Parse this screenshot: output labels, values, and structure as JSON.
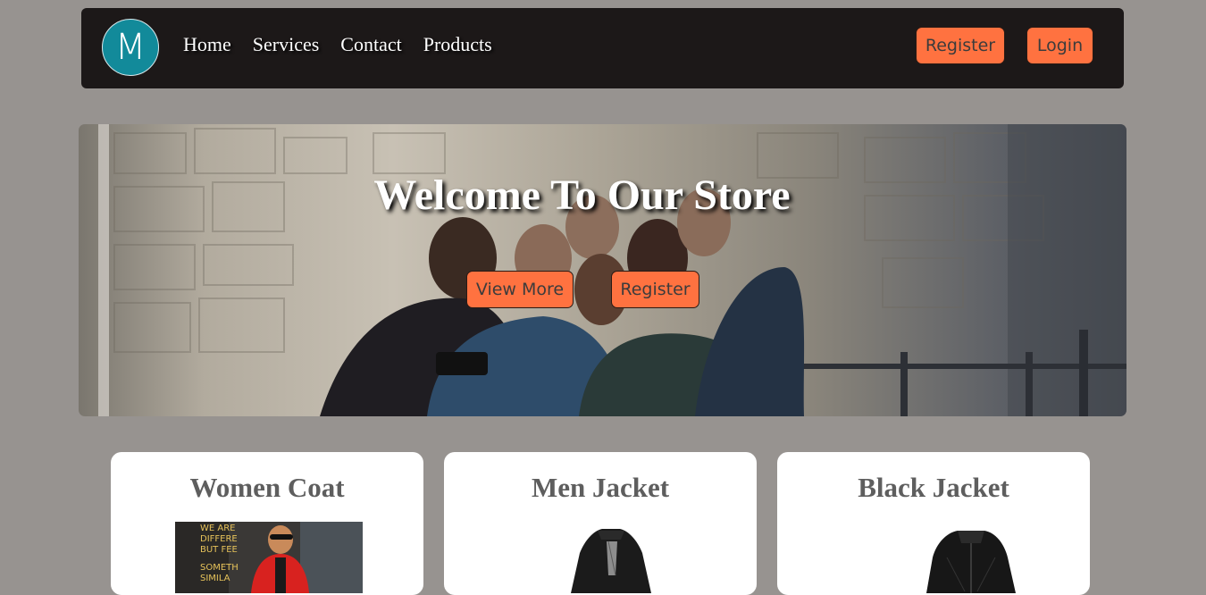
{
  "navbar": {
    "logo_letter": "M",
    "links": [
      "Home",
      "Services",
      "Contact",
      "Products"
    ],
    "register_label": "Register",
    "login_label": "Login"
  },
  "hero": {
    "title": "Welcome To Our Store",
    "view_more_label": "View More",
    "register_label": "Register"
  },
  "products": [
    {
      "title": "Women Coat",
      "image": "woman-red-coat-photo"
    },
    {
      "title": "Men Jacket",
      "image": "black-men-jacket-photo"
    },
    {
      "title": "Black Jacket",
      "image": "black-leather-jacket-photo"
    }
  ],
  "colors": {
    "page_bg": "#979390",
    "navbar_bg": "#1c1818",
    "logo_bg": "#128a9a",
    "button_bg": "#ff7240",
    "card_bg": "#ffffff"
  }
}
